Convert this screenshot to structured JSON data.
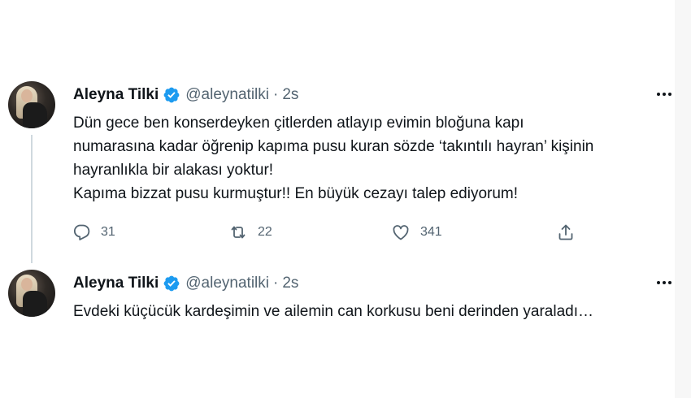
{
  "tweets": [
    {
      "author": {
        "name": "Aleyna Tilki",
        "handle": "@aleynatilki"
      },
      "separator": "·",
      "time": "2s",
      "text_lines": [
        "Dün gece ben konserdeyken çitlerden atlayıp evimin bloğuna kapı",
        "numarasına kadar öğrenip kapıma pusu kuran sözde ‘takıntılı hayran’ kişinin",
        "hayranlıkla bir alakası yoktur!",
        "Kapıma bizzat pusu kurmuştur!! En büyük cezayı talep ediyorum!"
      ],
      "actions": {
        "replies": "31",
        "retweets": "22",
        "likes": "341"
      },
      "icons": [
        "verified-icon",
        "more-icon",
        "reply-icon",
        "retweet-icon",
        "like-icon",
        "share-icon"
      ]
    },
    {
      "author": {
        "name": "Aleyna Tilki",
        "handle": "@aleynatilki"
      },
      "separator": "·",
      "time": "2s",
      "text_lines": [
        "Evdeki küçücük kardeşimin ve ailemin can korkusu beni derinden yaraladı…"
      ],
      "icons": [
        "verified-icon",
        "more-icon"
      ]
    }
  ],
  "colors": {
    "verified": "#1d9bf0",
    "text": "#0f1419",
    "secondary": "#536471",
    "thread_line": "#cfd9de"
  }
}
